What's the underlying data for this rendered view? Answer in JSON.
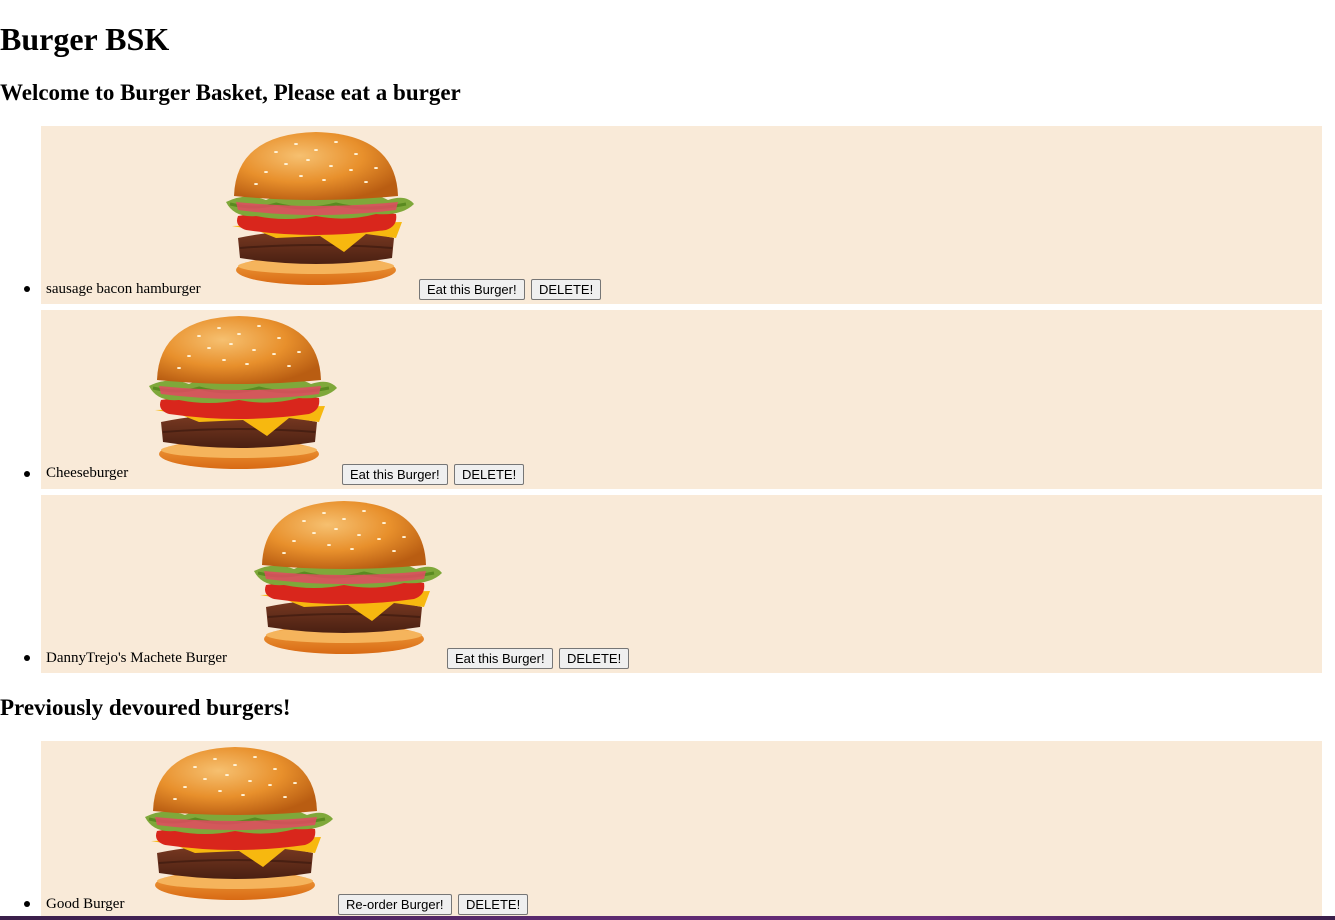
{
  "page": {
    "title": "Burger BSK",
    "welcome": "Welcome to Burger Basket, Please eat a burger",
    "devoured_heading": "Previously devoured burgers!"
  },
  "burgers": [
    {
      "name": "sausage bacon hamburger",
      "eat_label": "Eat this Burger!",
      "delete_label": "DELETE!"
    },
    {
      "name": "Cheeseburger",
      "eat_label": "Eat this Burger!",
      "delete_label": "DELETE!"
    },
    {
      "name": "DannyTrejo's Machete Burger",
      "eat_label": "Eat this Burger!",
      "delete_label": "DELETE!"
    }
  ],
  "devoured": [
    {
      "name": "Good Burger",
      "reorder_label": "Re-order Burger!",
      "delete_label": "DELETE!"
    }
  ],
  "icons": {
    "burger_image": "burger-icon"
  },
  "colors": {
    "item_background": "#f9ead8"
  }
}
